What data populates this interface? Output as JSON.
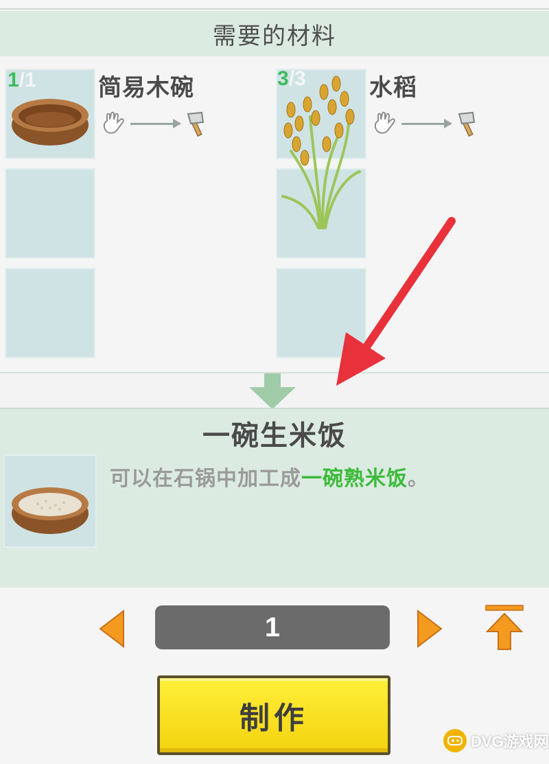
{
  "header": {
    "title": "需要的材料"
  },
  "materials": [
    {
      "name": "简易木碗",
      "have": "1",
      "need": "/1",
      "icon": "wooden-bowl-icon"
    },
    {
      "name": "水稻",
      "have": "3",
      "need": "/3",
      "icon": "rice-plant-icon"
    }
  ],
  "route_icons": [
    "hand-gather-icon",
    "axe-icon"
  ],
  "result": {
    "title": "一碗生米饭",
    "desc_prefix": "可以在石锅中加工成",
    "desc_highlight": "一碗熟米饭",
    "desc_suffix": "。",
    "icon": "rice-bowl-icon"
  },
  "controls": {
    "quantity": "1",
    "make_label": "制作"
  },
  "watermark": {
    "text": "DVG游戏网"
  },
  "colors": {
    "accent_green": "#3dbb5a",
    "panel_bg": "#dcebe2",
    "slot_bg": "#cfe3e5",
    "make_button": "#f7dd1b",
    "arrow_orange": "#f39a1f",
    "annotation_red": "#e8313b"
  }
}
